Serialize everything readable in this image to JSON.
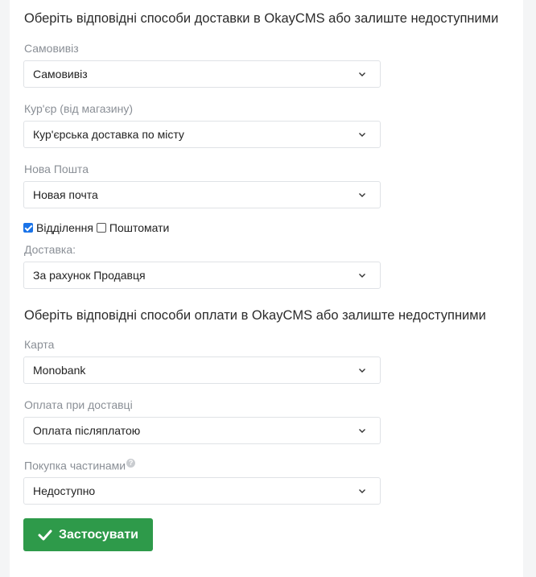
{
  "delivery": {
    "title": "Оберіть відповідні способи доставки в OkayCMS або залиште недоступними",
    "pickup": {
      "label": "Самовивіз",
      "value": "Самовивіз"
    },
    "courier": {
      "label": "Кур'єр (від магазину)",
      "value": "Кур'єрська доставка по місту"
    },
    "nova_poshta": {
      "label": "Нова Пошта",
      "value": "Новая почта"
    },
    "checkbox_branches": {
      "label": "Відділення",
      "checked": true
    },
    "checkbox_postomats": {
      "label": "Поштомати",
      "checked": false
    },
    "shipping_cost": {
      "label": "Доставка:",
      "value": "За рахунок Продавця"
    }
  },
  "payment": {
    "title": "Оберіть відповідні способи оплати в OkayCMS або залиште недоступними",
    "card": {
      "label": "Карта",
      "value": "Monobank"
    },
    "cod": {
      "label": "Оплата при доставці",
      "value": "Оплата післяплатою"
    },
    "installments": {
      "label": "Покупка частинами",
      "value": "Недоступно",
      "help_icon": "?"
    }
  },
  "apply_button": {
    "label": "Застосувати",
    "icon": "checkmark-icon"
  },
  "colors": {
    "accent_green": "#2e9a4a",
    "checkbox_blue": "#1a73e8",
    "label_gray": "#8a8f96"
  }
}
